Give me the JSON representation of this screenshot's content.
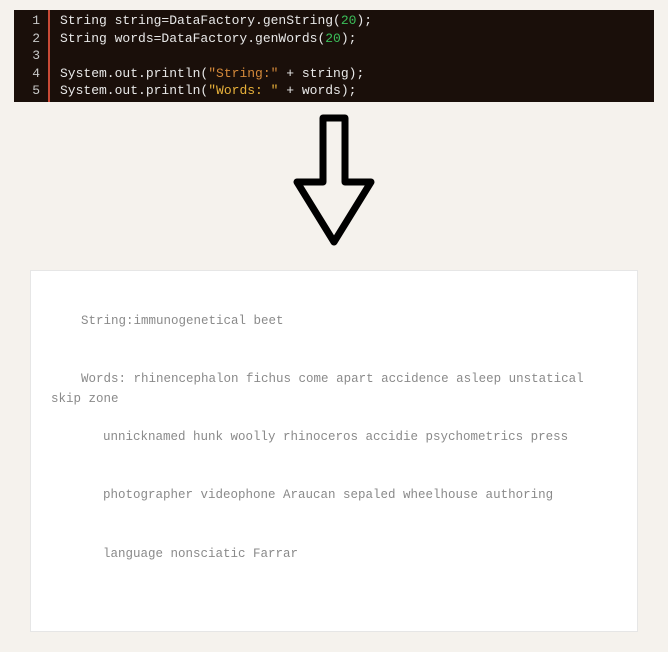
{
  "code": {
    "lines": [
      {
        "n": "1",
        "segments": [
          {
            "t": "String string=DataFactory.genString(",
            "c": "kw"
          },
          {
            "t": "20",
            "c": "num"
          },
          {
            "t": ");",
            "c": "kw"
          }
        ]
      },
      {
        "n": "2",
        "segments": [
          {
            "t": "String words=DataFactory.genWords(",
            "c": "kw"
          },
          {
            "t": "20",
            "c": "num"
          },
          {
            "t": ");",
            "c": "kw"
          }
        ]
      },
      {
        "n": "3",
        "segments": []
      },
      {
        "n": "4",
        "segments": [
          {
            "t": "System.out.println(",
            "c": "kw"
          },
          {
            "t": "\"String:\"",
            "c": "str"
          },
          {
            "t": " + string);",
            "c": "kw"
          }
        ]
      },
      {
        "n": "5",
        "segments": [
          {
            "t": "System.out.println(",
            "c": "kw"
          },
          {
            "t": "\"Words: \"",
            "c": "str-l"
          },
          {
            "t": " + words);",
            "c": "kw"
          }
        ]
      }
    ]
  },
  "output": {
    "line1_label": "String:",
    "line1_value": "immunogenetical beet",
    "line2_label": "Words: ",
    "line2_wrap": [
      "rhinencephalon fichus come apart accidence asleep unstatical skip zone",
      "unnicknamed hunk woolly rhinoceros accidie psychometrics press",
      "photographer videophone Araucan sepaled wheelhouse authoring",
      "language nonsciatic Farrar"
    ]
  }
}
